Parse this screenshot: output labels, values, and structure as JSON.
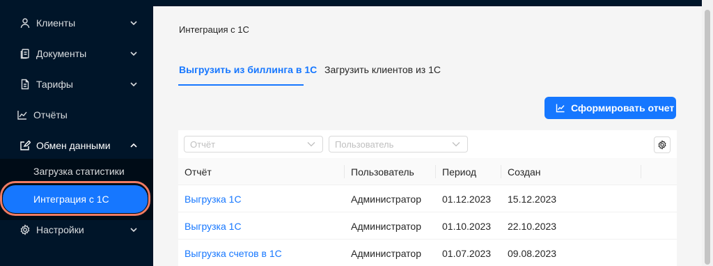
{
  "sidebar": {
    "items": [
      {
        "label": "Клиенты",
        "icon": "user-icon"
      },
      {
        "label": "Документы",
        "icon": "documents-icon"
      },
      {
        "label": "Тарифы",
        "icon": "tariff-icon"
      },
      {
        "label": "Отчёты",
        "icon": "line-chart-icon"
      },
      {
        "label": "Обмен данными",
        "icon": "edit-square-icon"
      },
      {
        "label": "Настройки",
        "icon": "gear-icon"
      }
    ],
    "submenu": [
      {
        "label": "Загрузка статистики"
      },
      {
        "label": "Интеграция с 1С"
      }
    ]
  },
  "main": {
    "page_title": "Интеграция с 1С",
    "tabs": [
      {
        "label": "Выгрузить из биллинга в 1С"
      },
      {
        "label": "Загрузить клиентов из 1С"
      }
    ],
    "report_button": "Сформировать отчет",
    "filters": {
      "report_placeholder": "Отчёт",
      "user_placeholder": "Пользователь"
    },
    "table": {
      "columns": [
        "Отчёт",
        "Пользователь",
        "Период",
        "Создан"
      ],
      "rows": [
        [
          "Выгрузка 1С",
          "Администратор",
          "01.12.2023",
          "15.12.2023"
        ],
        [
          "Выгрузка 1С",
          "Администратор",
          "01.10.2023",
          "22.10.2023"
        ],
        [
          "Выгрузка счетов в 1С",
          "Администратор",
          "01.07.2023",
          "09.08.2023"
        ]
      ]
    }
  },
  "colors": {
    "sidebar_bg": "#001529",
    "accent": "#1677ff",
    "highlight_ring": "#f07b63"
  }
}
